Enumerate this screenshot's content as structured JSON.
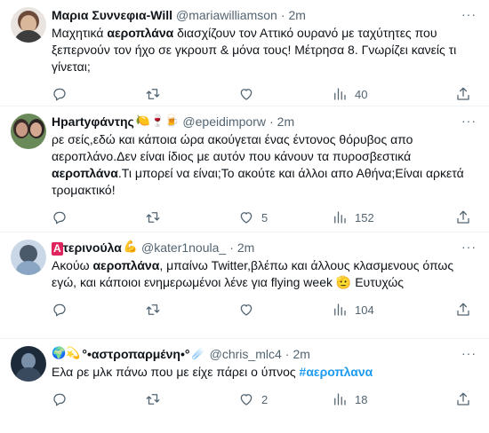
{
  "tweets": [
    {
      "name": "Μαρια Συννεφια-Will",
      "emoji": "",
      "handle": "@mariawilliamson",
      "dot": "·",
      "time": "2m",
      "more": "···",
      "text_parts": [
        "Μαχητικά ",
        "αεροπλάνα",
        " διασχίζουν τον Αττικό ουρανό με ταχύτητες που ξεπερνούν τον ήχο σε γκρουπ & μόνα τους! Μέτρησα 8. Γνωρίζει κανείς τι γίνεται;"
      ],
      "replies": "",
      "retweets": "",
      "likes": "",
      "views": "40",
      "avatar_colors": [
        "#6b4a3a",
        "#d9b79b"
      ]
    },
    {
      "name": "Ηpartyφάντης",
      "emoji": "🍋🍷🍺",
      "handle": "@epeidimporw",
      "dot": "·",
      "time": "2m",
      "more": "···",
      "text_parts": [
        "ρε σείς,εδώ και κάποια ώρα ακούγεται ένας έντονος θόρυβος απο αεροπλάνο.Δεν είναι ίδιος με αυτόν που κάνουν τα πυροσβεστικά ",
        "αεροπλάνα",
        ".Τι μπορεί να είναι;Το ακούτε και άλλοι απο Αθήνα;Είναι αρκετά τρομακτικό!"
      ],
      "replies": "",
      "retweets": "",
      "likes": "5",
      "views": "152",
      "avatar_colors": [
        "#3b2c2a",
        "#c99a86"
      ]
    },
    {
      "name_pill": "Α",
      "name": "τερινούλα",
      "emoji": "💪",
      "handle": "@kater1noula_",
      "dot": "·",
      "time": "2m",
      "more": "···",
      "text_parts": [
        "Ακούω ",
        "αεροπλάνα",
        ", μπαίνω Twitter,βλέπω και άλλους κλασμενους όπως εγώ, και κάποιοι ενημερωμένοι λένε για flying week 🫡 Ευτυχώς"
      ],
      "replies": "",
      "retweets": "",
      "likes": "",
      "views": "104",
      "avatar_colors": [
        "#8aa6c4",
        "#4a5a6a"
      ]
    },
    {
      "prefix_emoji": "🌍💫",
      "name": "°•αστροπαρμένη•°",
      "emoji": "☄️",
      "handle": "@chris_mlc4",
      "dot": "·",
      "time": "2m",
      "more": "···",
      "text_parts": [
        "Ελα ρε μλκ πάνω που με είχε πάρει ο ύπνος ",
        "#αεροπλανα",
        ""
      ],
      "replies": "",
      "retweets": "",
      "likes": "2",
      "views": "18",
      "avatar_colors": [
        "#1d2a3a",
        "#7a8fa8"
      ]
    }
  ],
  "icons": {
    "reply": "reply-icon",
    "retweet": "retweet-icon",
    "like": "heart-icon",
    "views": "views-icon",
    "share": "share-icon"
  }
}
